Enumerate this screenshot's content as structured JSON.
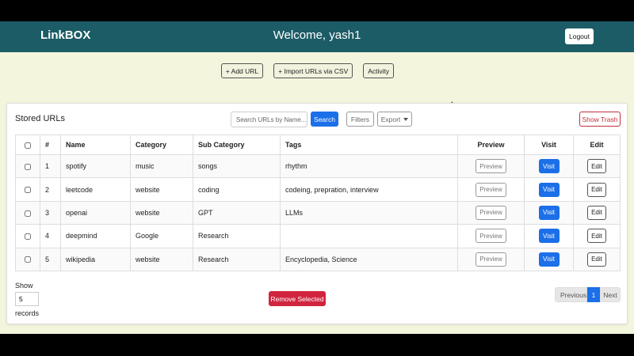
{
  "navbar": {
    "brand": "LinkBOX",
    "welcome": "Welcome, yash1",
    "logout_label": "Logout"
  },
  "actions": {
    "add_url": "+ Add URL",
    "import_csv": "+ Import URLs via CSV",
    "activity": "Activity"
  },
  "card": {
    "title": "Stored URLs",
    "search_placeholder": "Search URLs by Name...",
    "search_label": "Search",
    "filters_label": "Filters",
    "export_label": "Export",
    "show_trash_label": "Show Trash"
  },
  "table": {
    "headers": {
      "num": "#",
      "name": "Name",
      "category": "Category",
      "subcategory": "Sub Category",
      "tags": "Tags",
      "preview": "Preview",
      "visit": "Visit",
      "edit": "Edit"
    },
    "rows": [
      {
        "num": "1",
        "name": "spotify",
        "category": "music",
        "subcategory": "songs",
        "tags": "rhythm",
        "preview": "Preview",
        "visit": "Visit",
        "edit": "Edit"
      },
      {
        "num": "2",
        "name": "leetcode",
        "category": "website",
        "subcategory": "coding",
        "tags": "codeing, prepration, interview",
        "preview": "Preview",
        "visit": "Visit",
        "edit": "Edit"
      },
      {
        "num": "3",
        "name": "openai",
        "category": "website",
        "subcategory": "GPT",
        "tags": "LLMs",
        "preview": "Preview",
        "visit": "Visit",
        "edit": "Edit"
      },
      {
        "num": "4",
        "name": "deepmind",
        "category": "Google",
        "subcategory": "Research",
        "tags": "",
        "preview": "Preview",
        "visit": "Visit",
        "edit": "Edit"
      },
      {
        "num": "5",
        "name": "wikipedia",
        "category": "website",
        "subcategory": "Research",
        "tags": "Encyclopedia, Science",
        "preview": "Preview",
        "visit": "Visit",
        "edit": "Edit"
      }
    ]
  },
  "footer": {
    "show_label": "Show",
    "records_value": "5",
    "records_label": "records",
    "remove_selected": "Remove Selected",
    "pagination": {
      "previous": "Previous",
      "current": "1",
      "next": "Next"
    }
  },
  "colors": {
    "navbar": "#1c5c66",
    "page_bg": "#f4f5dd",
    "primary": "#1b6fe8",
    "danger": "#d1253f"
  }
}
